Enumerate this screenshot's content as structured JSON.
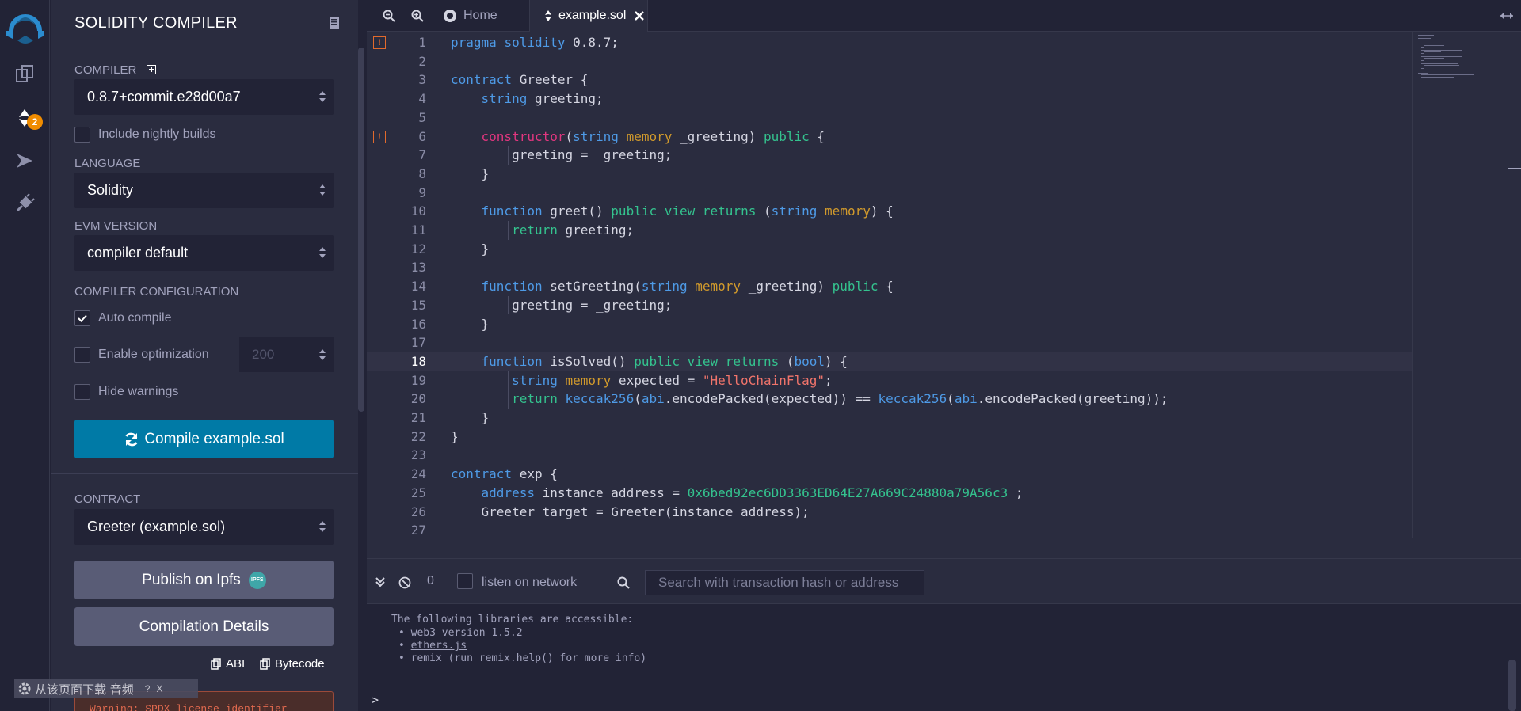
{
  "sidebar": {
    "badge_count": "2"
  },
  "panel": {
    "title": "SOLIDITY COMPILER",
    "compiler_label": "COMPILER",
    "compiler_version": "0.8.7+commit.e28d00a7",
    "nightly_label": "Include nightly builds",
    "language_label": "LANGUAGE",
    "language_value": "Solidity",
    "evm_label": "EVM VERSION",
    "evm_value": "compiler default",
    "config_label": "COMPILER CONFIGURATION",
    "auto_compile_label": "Auto compile",
    "optimization_label": "Enable optimization",
    "optimization_runs": "200",
    "hide_warnings_label": "Hide warnings",
    "compile_button": "Compile example.sol",
    "contract_label": "CONTRACT",
    "contract_value": "Greeter (example.sol)",
    "publish_button": "Publish on Ipfs",
    "ipfs_badge": "IPFS",
    "details_button": "Compilation Details",
    "abi_label": "ABI",
    "bytecode_label": "Bytecode",
    "warning_text": "Warning: SPDX license identifier",
    "overlay_text": "从该页面下载 音频",
    "overlay_help": "?",
    "overlay_close": "X"
  },
  "tabs": {
    "home": "Home",
    "file": "example.sol"
  },
  "editor": {
    "lines": [
      {
        "n": "1",
        "text": "pragma solidity 0.8.7;"
      },
      {
        "n": "2",
        "text": ""
      },
      {
        "n": "3",
        "text": "contract Greeter {"
      },
      {
        "n": "4",
        "text": "    string greeting;"
      },
      {
        "n": "5",
        "text": ""
      },
      {
        "n": "6",
        "text": "    constructor(string memory _greeting) public {"
      },
      {
        "n": "7",
        "text": "        greeting = _greeting;"
      },
      {
        "n": "8",
        "text": "    }"
      },
      {
        "n": "9",
        "text": ""
      },
      {
        "n": "10",
        "text": "    function greet() public view returns (string memory) {"
      },
      {
        "n": "11",
        "text": "        return greeting;"
      },
      {
        "n": "12",
        "text": "    }"
      },
      {
        "n": "13",
        "text": ""
      },
      {
        "n": "14",
        "text": "    function setGreeting(string memory _greeting) public {"
      },
      {
        "n": "15",
        "text": "        greeting = _greeting;"
      },
      {
        "n": "16",
        "text": "    }"
      },
      {
        "n": "17",
        "text": ""
      },
      {
        "n": "18",
        "text": "    function isSolved() public view returns (bool) {"
      },
      {
        "n": "19",
        "text": "        string memory expected = \"HelloChainFlag\";"
      },
      {
        "n": "20",
        "text": "        return keccak256(abi.encodePacked(expected)) == keccak256(abi.encodePacked(greeting));"
      },
      {
        "n": "21",
        "text": "    }"
      },
      {
        "n": "22",
        "text": "}"
      },
      {
        "n": "23",
        "text": ""
      },
      {
        "n": "24",
        "text": "contract exp {"
      },
      {
        "n": "25",
        "text": "    address instance_address = 0x6bed92ec6DD3363ED64E27A669C24880a79A56c3 ;"
      },
      {
        "n": "26",
        "text": "    Greeter target = Greeter(instance_address);"
      },
      {
        "n": "27",
        "text": ""
      }
    ],
    "warning_mark": "!"
  },
  "terminal": {
    "pending_count": "0",
    "listen_label": "listen on network",
    "search_placeholder": "Search with transaction hash or address",
    "intro": "The following libraries are accessible:",
    "lib1": "web3 version 1.5.2",
    "lib2": "ethers.js",
    "lib3": "remix (run remix.help() for more info)",
    "prompt": ">"
  }
}
